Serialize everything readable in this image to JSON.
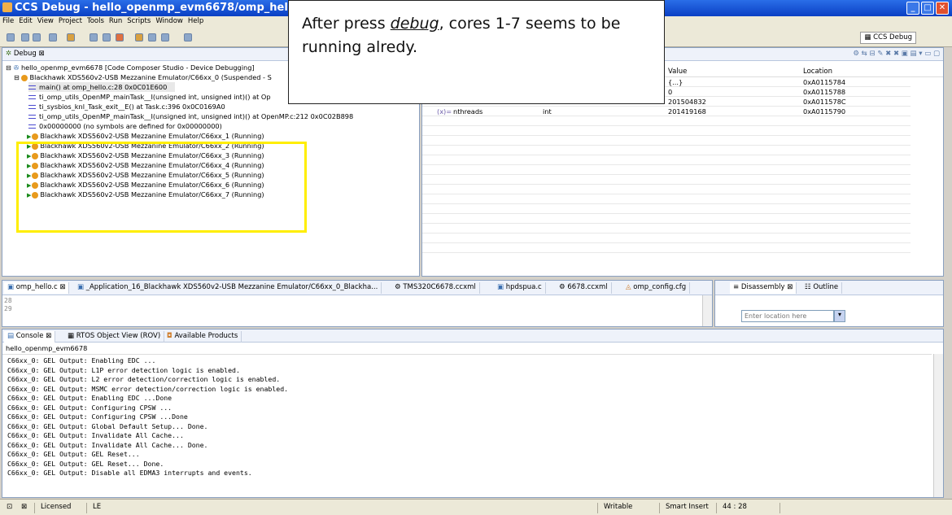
{
  "window": {
    "title": "CCS Debug - hello_openmp_evm6678/omp_hello.c"
  },
  "menu": [
    "File",
    "Edit",
    "View",
    "Project",
    "Tools",
    "Run",
    "Scripts",
    "Window",
    "Help"
  ],
  "toolbar": {
    "perspective_label": "CCS Debug"
  },
  "debug_view": {
    "tab_label": "Debug",
    "items": [
      "hello_openmp_evm6678 [Code Composer Studio - Device Debugging]",
      "Blackhawk XDS560v2-USB Mezzanine Emulator/C66xx_0 (Suspended - S",
      "main() at omp_hello.c:28 0x0C01E600",
      "ti_omp_utils_OpenMP_mainTask__I(unsigned int, unsigned int)() at Op",
      "ti_sysbios_knl_Task_exit__E() at Task.c:396 0x0C0169A0",
      "ti_omp_utils_OpenMP_mainTask__I(unsigned int, unsigned int)() at OpenMP.c:212 0x0C02B898",
      "0x00000000  (no symbols are defined for 0x00000000)",
      "Blackhawk XDS560v2-USB Mezzanine Emulator/C66xx_1 (Running)",
      "Blackhawk XDS560v2-USB Mezzanine Emulator/C66xx_2 (Running)",
      "Blackhawk XDS560v2-USB Mezzanine Emulator/C66xx_3 (Running)",
      "Blackhawk XDS560v2-USB Mezzanine Emulator/C66xx_4 (Running)",
      "Blackhawk XDS560v2-USB Mezzanine Emulator/C66xx_5 (Running)",
      "Blackhawk XDS560v2-USB Mezzanine Emulator/C66xx_6 (Running)",
      "Blackhawk XDS560v2-USB Mezzanine Emulator/C66xx_7 (Running)"
    ]
  },
  "variables_view": {
    "col_value": "Value",
    "col_location": "Location",
    "rows": [
      {
        "name": "",
        "type": "",
        "value": "{...}",
        "location": "0xA0115784"
      },
      {
        "name": "",
        "type": "",
        "value": "0",
        "location": "0xA0115788"
      },
      {
        "name": "",
        "type": "",
        "value": "201504832",
        "location": "0xA011578C"
      },
      {
        "name": "nthreads",
        "type": "int",
        "value": "201419168",
        "location": "0xA0115790"
      }
    ]
  },
  "callout": {
    "text_before": "After press ",
    "emphasis": "debug",
    "text_after": ", cores 1-7 seems to be running alredy."
  },
  "editor": {
    "tabs": [
      "omp_hello.c",
      "_Application_16_Blackhawk XDS560v2-USB Mezzanine Emulator/C66xx_0_Blackha...",
      "TMS320C6678.ccxml",
      "hpdspua.c",
      "6678.ccxml",
      "omp_config.cfg"
    ],
    "line_numbers": [
      "28",
      "29"
    ]
  },
  "disassembly": {
    "tabs": [
      "Disassembly",
      "Outline"
    ],
    "location_placeholder": "Enter location here"
  },
  "console": {
    "tabs": [
      "Console",
      "RTOS Object View (ROV)",
      "Available Products"
    ],
    "project": "hello_openmp_evm6678",
    "lines": [
      "C66xx_0: GEL Output: Enabling EDC ...",
      "C66xx_0: GEL Output: L1P error detection logic is enabled.",
      "C66xx_0: GEL Output: L2 error detection/correction logic is enabled.",
      "C66xx_0: GEL Output: MSMC error detection/correction logic is enabled.",
      "C66xx_0: GEL Output: Enabling EDC ...Done",
      "C66xx_0: GEL Output: Configuring CPSW ...",
      "C66xx_0: GEL Output: Configuring CPSW ...Done",
      "C66xx_0: GEL Output: Global Default Setup... Done.",
      "C66xx_0: GEL Output: Invalidate All Cache...",
      "C66xx_0: GEL Output: Invalidate All Cache... Done.",
      "C66xx_0: GEL Output: GEL Reset...",
      "C66xx_0: GEL Output: GEL Reset... Done.",
      "C66xx_0: GEL Output: Disable all EDMA3 interrupts and events."
    ]
  },
  "status": {
    "licensed": "Licensed",
    "endian": "LE",
    "writable": "Writable",
    "insert_mode": "Smart Insert",
    "position": "44 : 28"
  }
}
